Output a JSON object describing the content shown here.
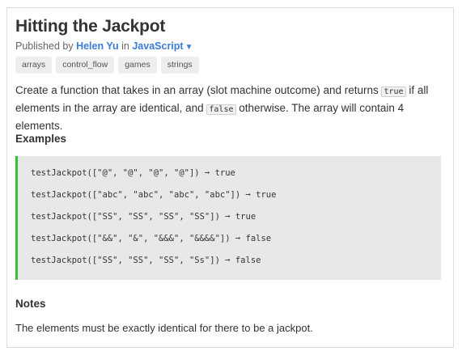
{
  "challenge": {
    "title": "Hitting the Jackpot",
    "published_prefix": "Published by",
    "author": "Helen Yu",
    "in_word": "in",
    "language": "JavaScript",
    "tags": [
      "arrays",
      "control_flow",
      "games",
      "strings"
    ],
    "description": {
      "part1": "Create a function that takes in an array (slot machine outcome) and returns ",
      "code_true": "true",
      "part2": " if all elements in the array are identical, and ",
      "code_false": "false",
      "part3": " otherwise. The array will contain 4 elements."
    },
    "examples_heading": "Examples",
    "examples": [
      "testJackpot([\"@\", \"@\", \"@\", \"@\"]) ➞ true",
      "testJackpot([\"abc\", \"abc\", \"abc\", \"abc\"]) ➞ true",
      "testJackpot([\"SS\", \"SS\", \"SS\", \"SS\"]) ➞ true",
      "testJackpot([\"&&\", \"&\", \"&&&\", \"&&&&\"]) ➞ false",
      "testJackpot([\"SS\", \"SS\", \"SS\", \"Ss\"]) ➞ false"
    ],
    "notes_heading": "Notes",
    "notes": "The elements must be exactly identical for there to be a jackpot."
  },
  "colors": {
    "link": "#3b7dd8",
    "example_accent": "#35c135",
    "example_bg": "#e8e8e8",
    "tag_bg": "#eeeeee"
  },
  "icons": {
    "language_dropdown": "caret-down-icon"
  }
}
